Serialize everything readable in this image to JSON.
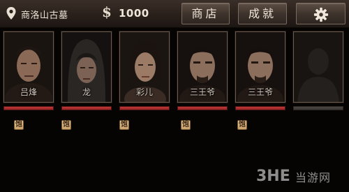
{
  "header": {
    "location_name": "商洛山古墓",
    "currency_symbol": "$",
    "money": "1000",
    "shop_label": "商店",
    "achievements_label": "成就",
    "settings_icon": "gear-icon",
    "location_icon": "map-pin-icon"
  },
  "party": [
    {
      "name": "吕烽",
      "hp": 1.0,
      "status": "饱"
    },
    {
      "name": "龙",
      "hp": 1.0,
      "status": "饱"
    },
    {
      "name": "彩儿",
      "hp": 1.0,
      "status": "饱"
    },
    {
      "name": "三王爷",
      "hp": 1.0,
      "status": "饱"
    },
    {
      "name": "三王爷",
      "hp": 1.0,
      "status": "饱"
    },
    {
      "name": "",
      "hp": 0.0,
      "status": ""
    }
  ],
  "watermark": {
    "text": "当游网",
    "logo": "3HE"
  },
  "colors": {
    "hp": "#b12e2e",
    "hp_empty": "#45413e",
    "status_badge": "#d9b988",
    "header_bg": "#2e241f"
  }
}
